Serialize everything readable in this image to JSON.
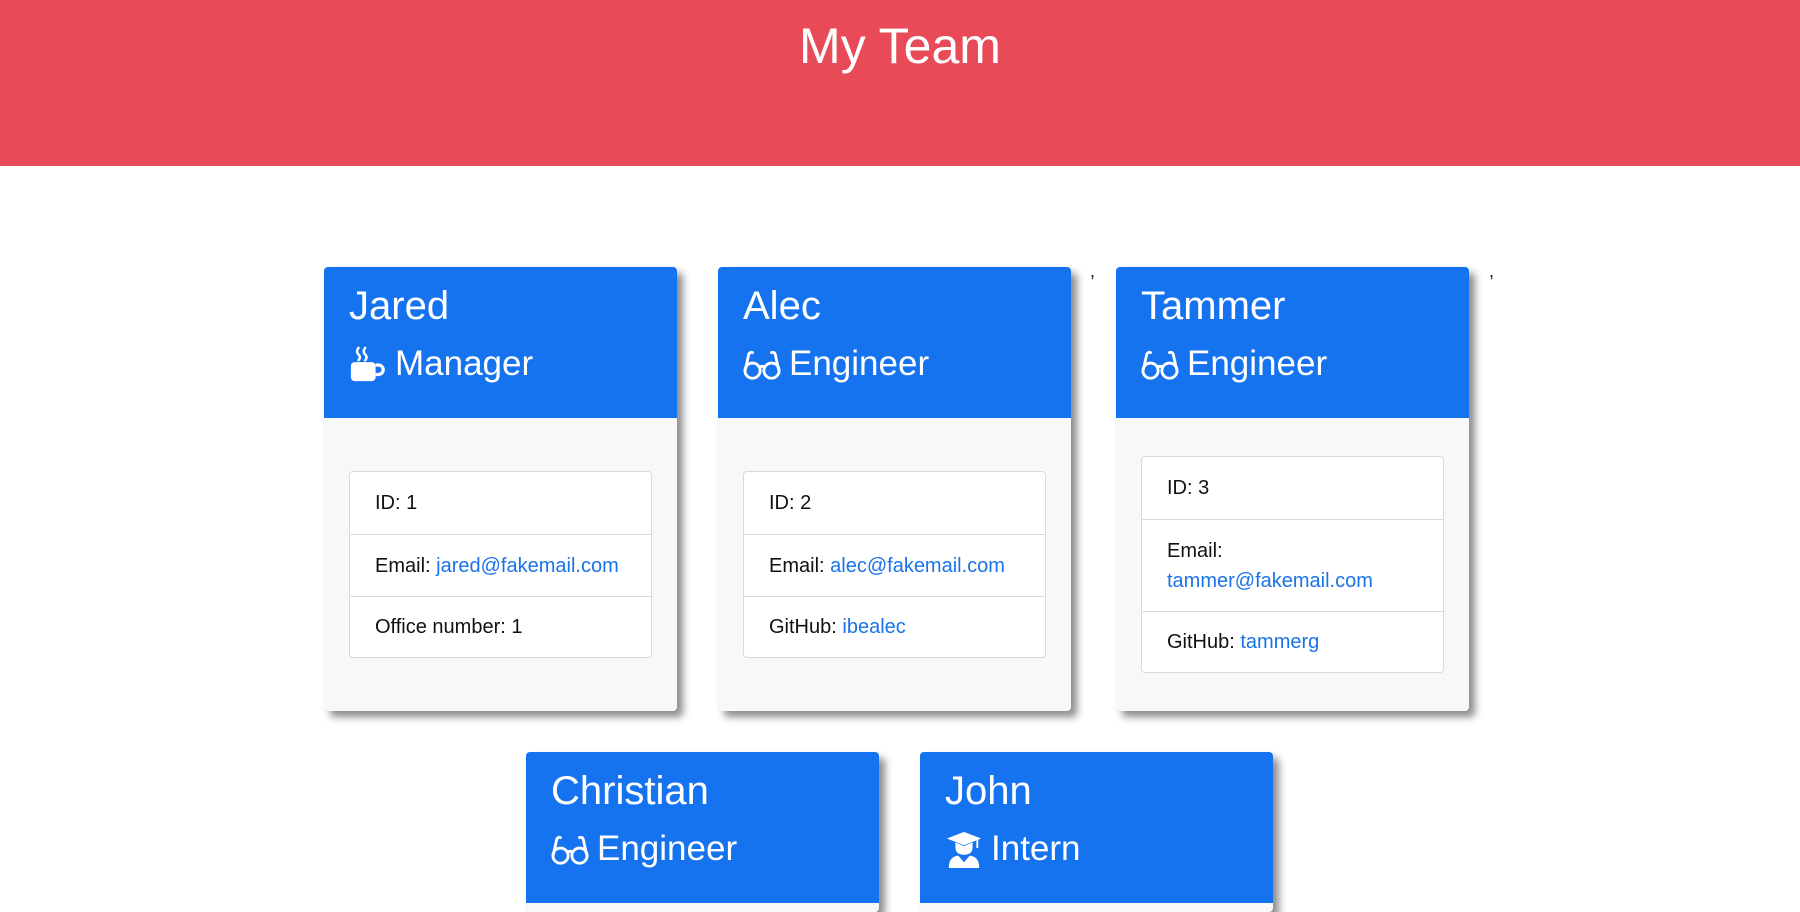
{
  "header": {
    "title": "My Team"
  },
  "stray": {
    "comma1": ",",
    "comma2": ","
  },
  "cards": [
    {
      "name": "Jared",
      "role": "Manager",
      "icon": "coffee-mug-icon",
      "id_label": "ID: 1",
      "email_label": "Email:",
      "email": "jared@fakemail.com",
      "extra_label": "Office number: 1",
      "extra_value": ""
    },
    {
      "name": "Alec",
      "role": "Engineer",
      "icon": "glasses-icon",
      "id_label": "ID: 2",
      "email_label": "Email:",
      "email": "alec@fakemail.com",
      "extra_label": "GitHub:",
      "extra_value": "ibealec"
    },
    {
      "name": "Tammer",
      "role": "Engineer",
      "icon": "glasses-icon",
      "id_label": "ID: 3",
      "email_label": "Email:",
      "email": "tammer@fakemail.com",
      "extra_label": "GitHub:",
      "extra_value": "tammerg"
    },
    {
      "name": "Christian",
      "role": "Engineer",
      "icon": "glasses-icon"
    },
    {
      "name": "John",
      "role": "Intern",
      "icon": "graduate-icon"
    }
  ],
  "colors": {
    "header_bg": "#e84a57",
    "card_header_bg": "#1673f0",
    "link": "#1a73e8"
  }
}
